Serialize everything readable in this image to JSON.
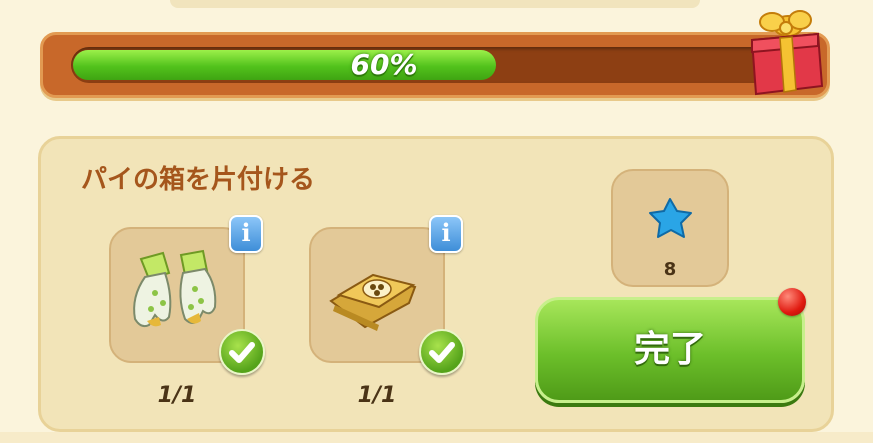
{
  "progress": {
    "percent_label": "60%",
    "fraction": 0.6,
    "fill_color": "#52c21c",
    "reward_icon": "gift-box-icon"
  },
  "task": {
    "title": "パイの箱を片付ける",
    "items": [
      {
        "icon": "garden-gloves-icon",
        "count": "1/1",
        "completed": true,
        "info_label": "i"
      },
      {
        "icon": "pie-cloth-icon",
        "count": "1/1",
        "completed": true,
        "info_label": "i"
      }
    ],
    "reward": {
      "icon": "blue-star-icon",
      "count": "8"
    },
    "complete_button": {
      "label": "完了",
      "notification": true
    }
  },
  "colors": {
    "accent_green": "#6cbf2a",
    "title_brown": "#a5561c",
    "info_blue": "#3e8ed8",
    "badge_red": "#e01a10"
  }
}
